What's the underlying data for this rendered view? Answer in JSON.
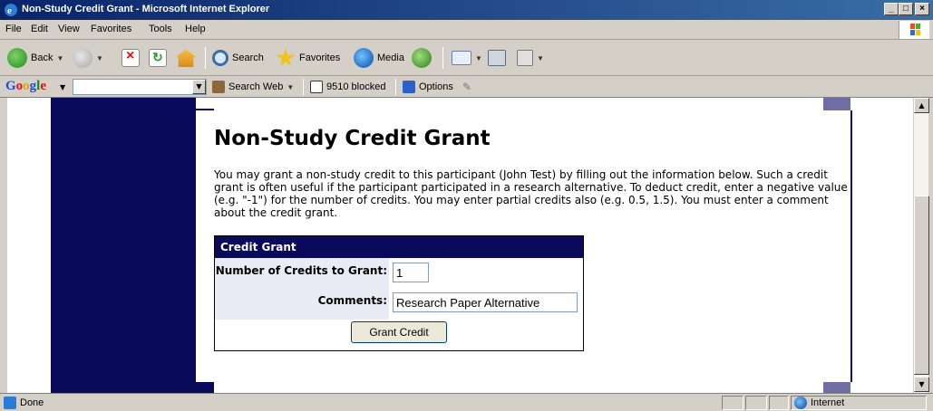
{
  "window": {
    "title": "Non-Study Credit Grant - Microsoft Internet Explorer",
    "buttons": {
      "minimize": "_",
      "maximize": "□",
      "close": "×"
    }
  },
  "menubar": {
    "items": [
      "File",
      "Edit",
      "View",
      "Favorites",
      "Tools",
      "Help"
    ]
  },
  "toolbar": {
    "back_label": "Back",
    "search_label": "Search",
    "favorites_label": "Favorites",
    "media_label": "Media"
  },
  "googlebar": {
    "logo": [
      "G",
      "o",
      "o",
      "g",
      "l",
      "e"
    ],
    "search_input_value": "",
    "search_web_label": "Search Web",
    "blocked_label": "9510 blocked",
    "options_label": "Options"
  },
  "page": {
    "heading": "Non-Study Credit Grant",
    "description": "You may grant a non-study credit to this participant (John Test) by filling out the information below. Such a credit grant is often useful if the participant participated in a research alternative. To deduct credit, enter a negative value (e.g. \"-1\") for the number of credits. You may enter partial credits also (e.g. 0.5, 1.5). You must enter a comment about the credit grant.",
    "form": {
      "header": "Credit Grant",
      "credits_label": "Number of Credits to Grant:",
      "credits_value": "1",
      "comments_label": "Comments:",
      "comments_value": "Research Paper Alternative",
      "submit_label": "Grant Credit"
    }
  },
  "statusbar": {
    "status": "Done",
    "zone": "Internet"
  },
  "colors": {
    "navy": "#0a0a5c",
    "lavender": "#6e6ea3",
    "title_gradient_start": "#0a246a"
  }
}
